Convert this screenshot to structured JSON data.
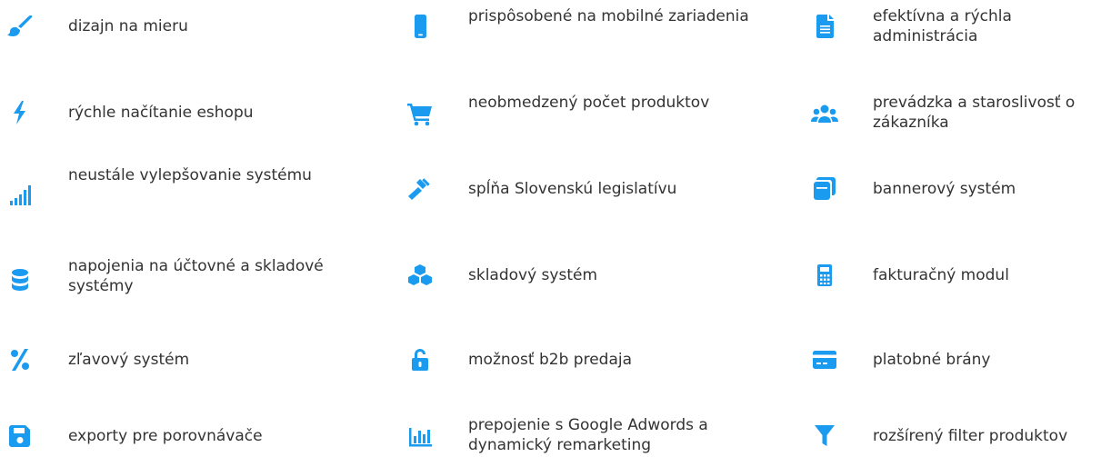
{
  "accent_color": "#1a9bf0",
  "columns": [
    {
      "items": [
        {
          "icon": "paintbrush-icon",
          "label": "dizajn na mieru"
        },
        {
          "icon": "lightning-bolt-icon",
          "label": "rýchle načítanie eshopu"
        },
        {
          "icon": "signal-bars-icon",
          "label": "neustále vylepšovanie systému"
        },
        {
          "icon": "database-icon",
          "label": "napojenia na účtovné a skladové systémy"
        },
        {
          "icon": "percent-icon",
          "label": "zľavový systém"
        },
        {
          "icon": "floppy-disk-icon",
          "label": "exporty pre porovnávače"
        }
      ]
    },
    {
      "items": [
        {
          "icon": "mobile-phone-icon",
          "label": "prispôsobené na mobilné zariadenia"
        },
        {
          "icon": "shopping-cart-icon",
          "label": "neobmedzený počet produktov"
        },
        {
          "icon": "gavel-icon",
          "label": "spĺňa Slovenskú legislatívu"
        },
        {
          "icon": "cubes-icon",
          "label": "skladový systém"
        },
        {
          "icon": "unlock-icon",
          "label": "možnosť b2b predaja"
        },
        {
          "icon": "bar-chart-icon",
          "label": "prepojenie s Google Adwords a dynamický remarketing"
        }
      ]
    },
    {
      "items": [
        {
          "icon": "document-icon",
          "label": "efektívna a rýchla administrácia"
        },
        {
          "icon": "users-icon",
          "label": "prevádzka a staroslivosť o zákazníka"
        },
        {
          "icon": "clone-icon",
          "label": "bannerový systém"
        },
        {
          "icon": "calculator-icon",
          "label": "fakturačný modul"
        },
        {
          "icon": "credit-card-icon",
          "label": "platobné brány"
        },
        {
          "icon": "filter-icon",
          "label": "rozšírený filter produktov"
        }
      ]
    }
  ]
}
